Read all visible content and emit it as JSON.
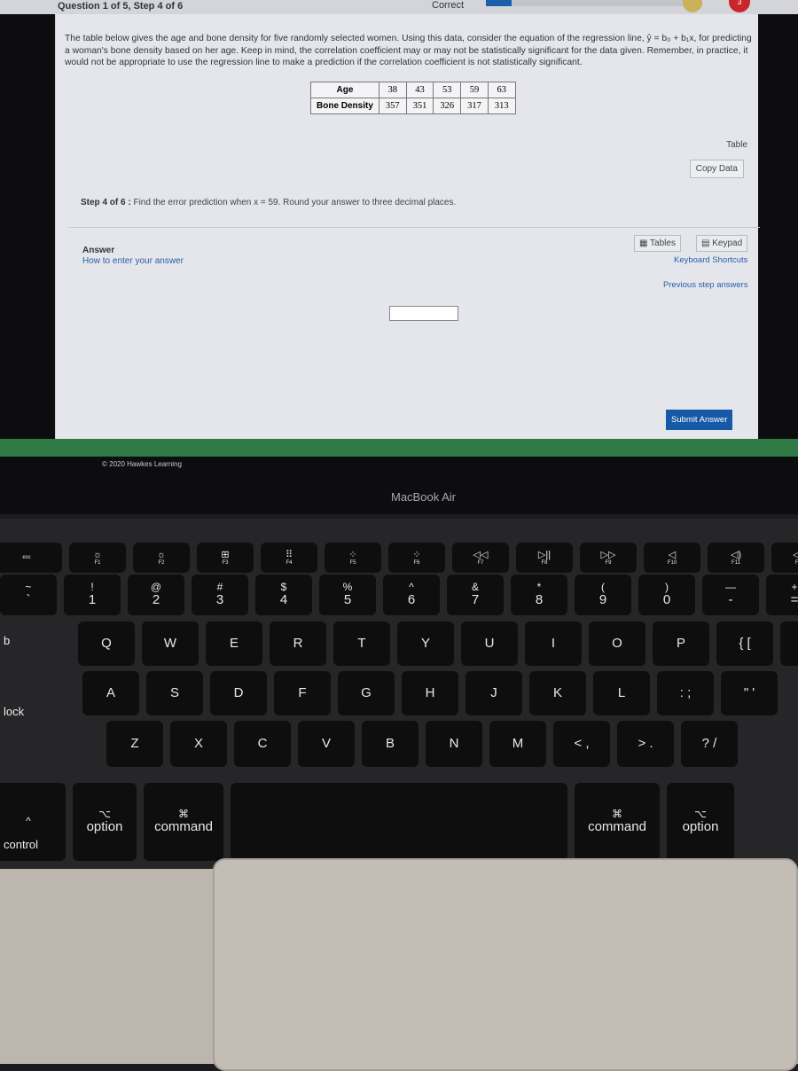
{
  "header": {
    "question_label": "Question 1 of 5, Step 4 of 6",
    "status": "Correct",
    "progress": 0.12,
    "hearts": "3"
  },
  "problem": {
    "intro": "The table below gives the age and bone density for five randomly selected women. Using this data, consider the equation of the regression line, ŷ = b₀ + b₁x, for predicting a woman's bone density based on her age. Keep in mind, the correlation coefficient may or may not be statistically significant for the data given. Remember, in practice, it would not be appropriate to use the regression line to make a prediction if the correlation coefficient is not statistically significant.",
    "table": {
      "row1_label": "Age",
      "row1": [
        "38",
        "43",
        "53",
        "59",
        "63"
      ],
      "row2_label": "Bone Density",
      "row2": [
        "357",
        "351",
        "326",
        "317",
        "313"
      ]
    },
    "table_link": "Table",
    "copy_data": "Copy Data",
    "step_label": "Step 4 of 6 :",
    "step_text": "Find the error prediction when x = 59. Round your answer to three decimal places."
  },
  "answer": {
    "label": "Answer",
    "how_to": "How to enter your answer",
    "tables": "Tables",
    "keypad": "Keypad",
    "shortcuts": "Keyboard Shortcuts",
    "previous": "Previous step answers",
    "value": "",
    "submit": "Submit Answer"
  },
  "footer": "© 2020 Hawkes Learning",
  "laptop_brand": "MacBook Air",
  "keyboard": {
    "fn_row": [
      [
        "",
        "esc"
      ],
      [
        "☼",
        "F1"
      ],
      [
        "☼",
        "F2"
      ],
      [
        "⊞",
        "F3"
      ],
      [
        "⠿",
        "F4"
      ],
      [
        "⁘",
        "F5"
      ],
      [
        "⁘",
        "F6"
      ],
      [
        "◁◁",
        "F7"
      ],
      [
        "▷||",
        "F8"
      ],
      [
        "▷▷",
        "F9"
      ],
      [
        "◁",
        "F10"
      ],
      [
        "◁)",
        "F11"
      ],
      [
        "◁))",
        "F12"
      ]
    ],
    "num_row": [
      [
        "~",
        "`"
      ],
      [
        "!",
        "1"
      ],
      [
        "@",
        "2"
      ],
      [
        "#",
        "3"
      ],
      [
        "$",
        "4"
      ],
      [
        "%",
        "5"
      ],
      [
        "^",
        "6"
      ],
      [
        "&",
        "7"
      ],
      [
        "*",
        "8"
      ],
      [
        "(",
        "9"
      ],
      [
        ")",
        "0"
      ],
      [
        "—",
        "-"
      ],
      [
        "+",
        "="
      ]
    ],
    "q_row": [
      "Q",
      "W",
      "E",
      "R",
      "T",
      "Y",
      "U",
      "I",
      "O",
      "P",
      "{ [",
      "} ]"
    ],
    "a_row": [
      "A",
      "S",
      "D",
      "F",
      "G",
      "H",
      "J",
      "K",
      "L",
      ": ;",
      "\" '"
    ],
    "z_row": [
      "Z",
      "X",
      "C",
      "V",
      "B",
      "N",
      "M",
      "< ,",
      "> .",
      "? /"
    ],
    "side_labels": {
      "tab": "b",
      "caps": "lock",
      "control": "control"
    },
    "bottom_row": [
      [
        "^",
        ""
      ],
      [
        "⌥",
        "option"
      ],
      [
        "⌘",
        "command"
      ],
      [
        "",
        ""
      ],
      [
        "⌘",
        "command"
      ],
      [
        "⌥",
        "option"
      ]
    ]
  }
}
